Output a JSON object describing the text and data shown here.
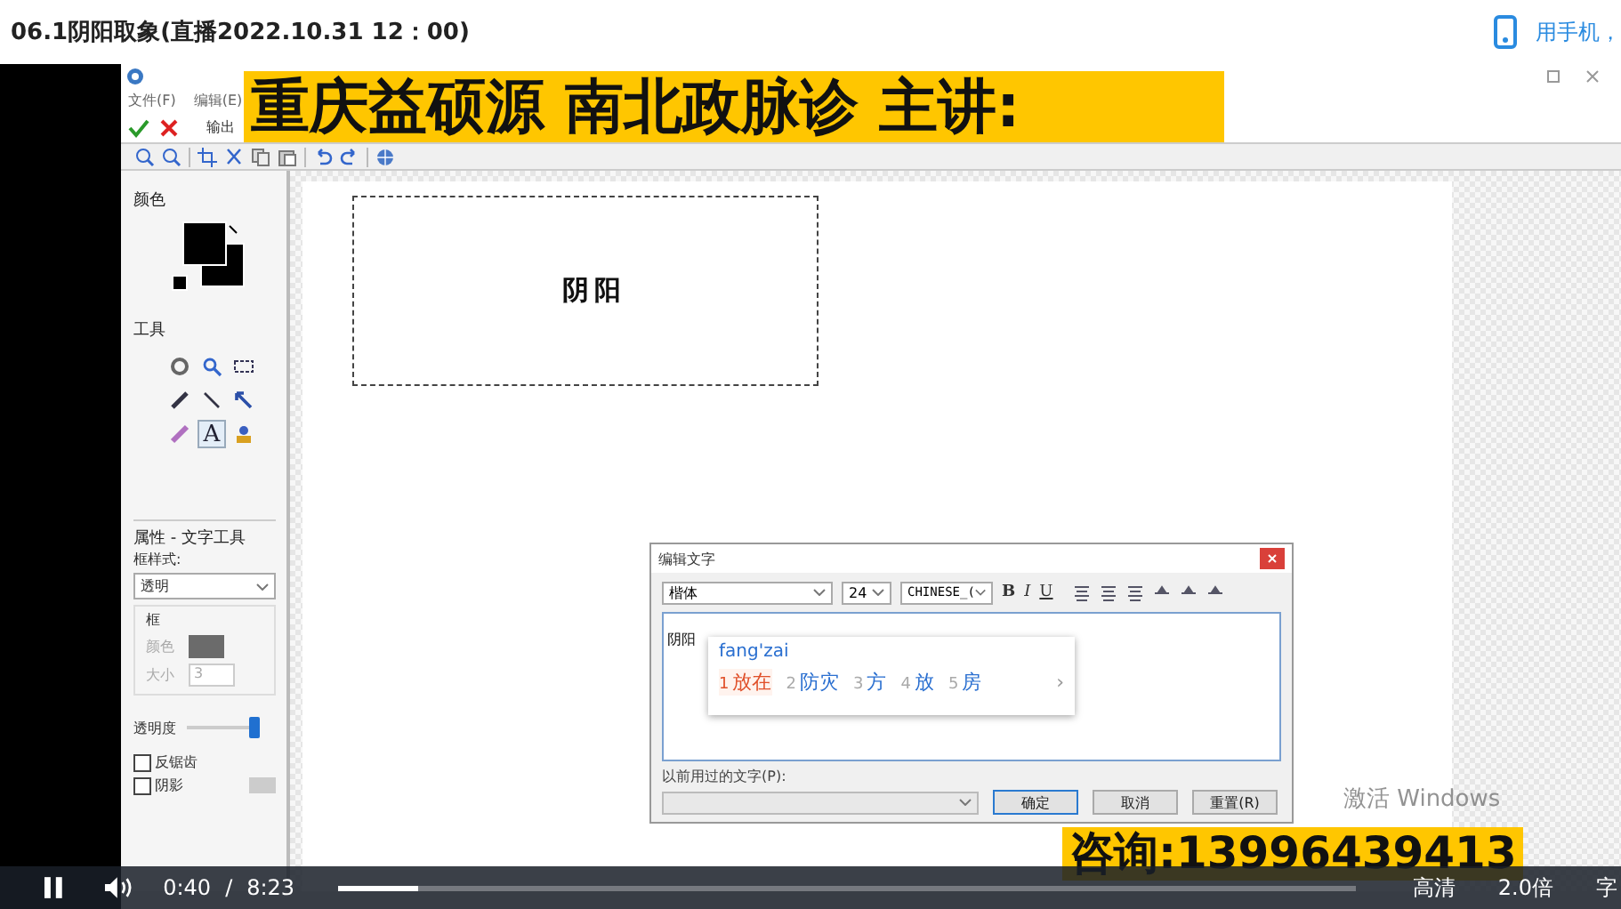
{
  "header": {
    "title": "06.1阴阳取象(直播2022.10.31 12：00)",
    "mobile_link": "用手机，"
  },
  "banner": {
    "text": "重庆益硕源 南北政脉诊 主讲:"
  },
  "app": {
    "menu": [
      "文件(F)",
      "编辑(E)"
    ],
    "output_label": "输出",
    "panel": {
      "color_heading": "颜色",
      "tools_heading": "工具",
      "tools": [
        {
          "kind": "blur",
          "selected": false
        },
        {
          "kind": "zoom",
          "selected": false
        },
        {
          "kind": "select",
          "selected": false
        },
        {
          "kind": "pen",
          "selected": false
        },
        {
          "kind": "line",
          "selected": false
        },
        {
          "kind": "arrow",
          "selected": false
        },
        {
          "kind": "highlighter",
          "selected": false
        },
        {
          "kind": "text",
          "label": "A",
          "selected": true
        },
        {
          "kind": "stamp",
          "selected": false
        }
      ],
      "properties_heading": "属性 - 文字工具",
      "frame_style_label": "框样式:",
      "frame_style_value": "透明",
      "frame_group": "框",
      "color_label": "颜色",
      "size_label": "大小",
      "size_value": "3",
      "opacity_label": "透明度",
      "opacity": {
        "level": 0.95
      },
      "checkboxes": [
        {
          "label": "反锯齿",
          "checked": false
        },
        {
          "label": "阴影",
          "checked": false
        }
      ]
    },
    "canvas": {
      "text": "阴阳"
    }
  },
  "dialog": {
    "title": "编辑文字",
    "font": "楷体",
    "size": "24",
    "charset": "CHINESE_(",
    "format": [
      "B",
      "I",
      "U"
    ],
    "text": "阴阳",
    "ime": {
      "input": "fang'zai",
      "candidates": [
        {
          "index": "1",
          "text": "放在",
          "selected": true
        },
        {
          "index": "2",
          "text": "防灾",
          "selected": false
        },
        {
          "index": "3",
          "text": "方",
          "selected": false
        },
        {
          "index": "4",
          "text": "放",
          "selected": false
        },
        {
          "index": "5",
          "text": "房",
          "selected": false
        }
      ],
      "more": "›"
    },
    "history_label": "以前用过的文字(P):",
    "buttons": [
      {
        "label": "确定",
        "default": true
      },
      {
        "label": "取消",
        "default": false
      },
      {
        "label": "重置(R)",
        "default": false
      }
    ]
  },
  "activation": "激活 Windows",
  "phone_banner": "咨询:13996439413",
  "player": {
    "playing": true,
    "current": "0:40",
    "separator": "/",
    "duration": "8:23",
    "level": 0.08,
    "quality": "高清",
    "speed": "2.0倍",
    "subtitle": "字"
  }
}
